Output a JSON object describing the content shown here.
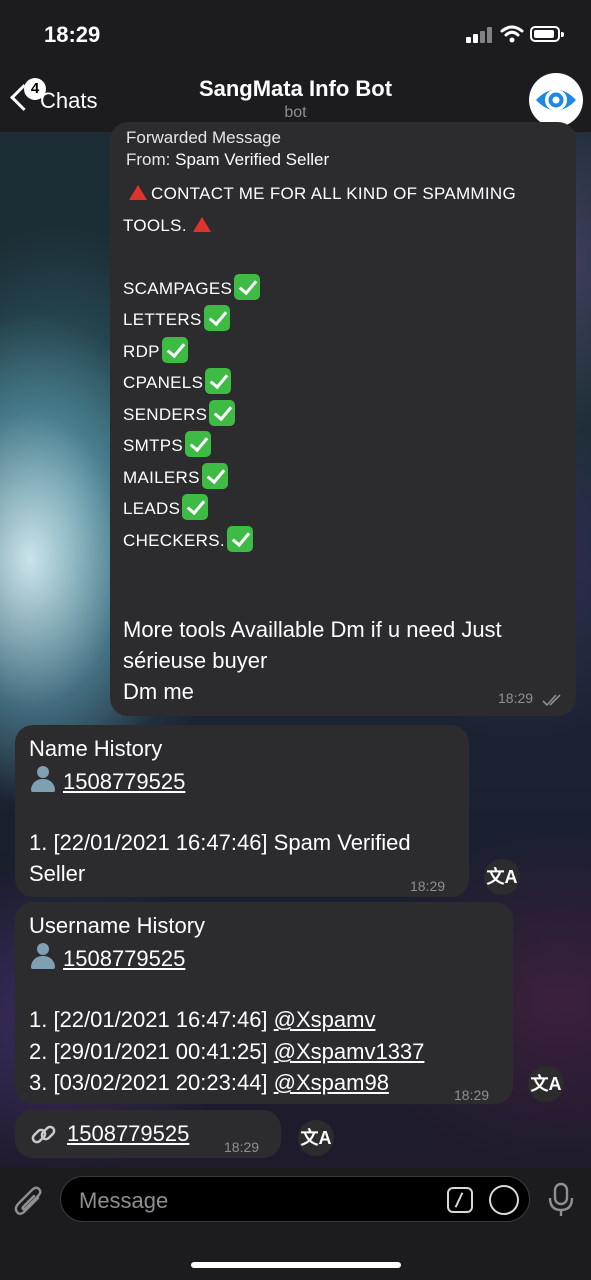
{
  "status": {
    "time": "18:29"
  },
  "header": {
    "back_label": "Chats",
    "unread_badge": "4",
    "title": "SangMata Info Bot",
    "subtitle": "bot",
    "avatar_icon": "eye-icon"
  },
  "forwarded": {
    "label": "Forwarded Message",
    "from_prefix": "From:",
    "from_name": "Spam Verified Seller",
    "headline_1": "CONTACT ME FOR ALL KIND OF SPAMMING",
    "headline_2": "TOOLS.",
    "items": [
      "SCAMPAGES",
      "LETTERS",
      "RDP",
      "CPANELS",
      "SENDERS",
      "SMTPS",
      "MAILERS",
      "LEADS",
      "CHECKERS."
    ],
    "tail_1": "More tools Availlable Dm if u need Just",
    "tail_2": "sérieuse buyer",
    "tail_3": "Dm me",
    "time": "18:29"
  },
  "name_history": {
    "title": "Name History",
    "user_id": "1508779525",
    "entry_1a": "1. [22/01/2021 16:47:46] Spam Verified",
    "entry_1b": "Seller",
    "time": "18:29"
  },
  "username_history": {
    "title": "Username History",
    "user_id": "1508779525",
    "entries": [
      {
        "prefix": "1. [22/01/2021 16:47:46] ",
        "handle": "@Xspamv"
      },
      {
        "prefix": "2. [29/01/2021 00:41:25] ",
        "handle": "@Xspamv1337"
      },
      {
        "prefix": "3. [03/02/2021 20:23:44] ",
        "handle": "@Xspam98"
      }
    ],
    "time": "18:29"
  },
  "link_message": {
    "user_id": "1508779525",
    "time": "18:29"
  },
  "input": {
    "placeholder": "Message"
  }
}
